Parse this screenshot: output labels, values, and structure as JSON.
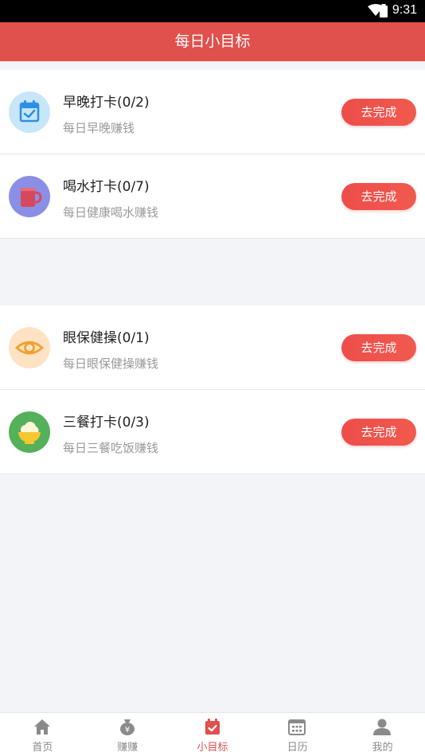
{
  "status_bar": {
    "time": "9:31"
  },
  "header": {
    "title": "每日小目标"
  },
  "tasks_group1": [
    {
      "title": "早晚打卡(0/2)",
      "subtitle": "每日早晚赚钱",
      "button": "去完成",
      "icon": "calendar-check-icon",
      "icon_bg": "#c7e6f8"
    },
    {
      "title": "喝水打卡(0/7)",
      "subtitle": "每日健康喝水赚钱",
      "button": "去完成",
      "icon": "mug-icon",
      "icon_bg": "#8a8fe6"
    }
  ],
  "tasks_group2": [
    {
      "title": "眼保健操(0/1)",
      "subtitle": "每日眼保健操赚钱",
      "button": "去完成",
      "icon": "eye-icon",
      "icon_bg": "#fde3c3"
    },
    {
      "title": "三餐打卡(0/3)",
      "subtitle": "每日三餐吃饭赚钱",
      "button": "去完成",
      "icon": "rice-bowl-icon",
      "icon_bg": "#55b05a"
    }
  ],
  "tabbar": {
    "items": [
      {
        "label": "首页",
        "icon": "home-icon"
      },
      {
        "label": "赚赚",
        "icon": "money-bag-icon"
      },
      {
        "label": "小目标",
        "icon": "calendar-check-icon",
        "active": true
      },
      {
        "label": "日历",
        "icon": "calendar-icon"
      },
      {
        "label": "我的",
        "icon": "profile-icon"
      }
    ]
  },
  "colors": {
    "accent": "#e0504d",
    "button": "#ef4f4b",
    "background": "#f3f4f8"
  }
}
